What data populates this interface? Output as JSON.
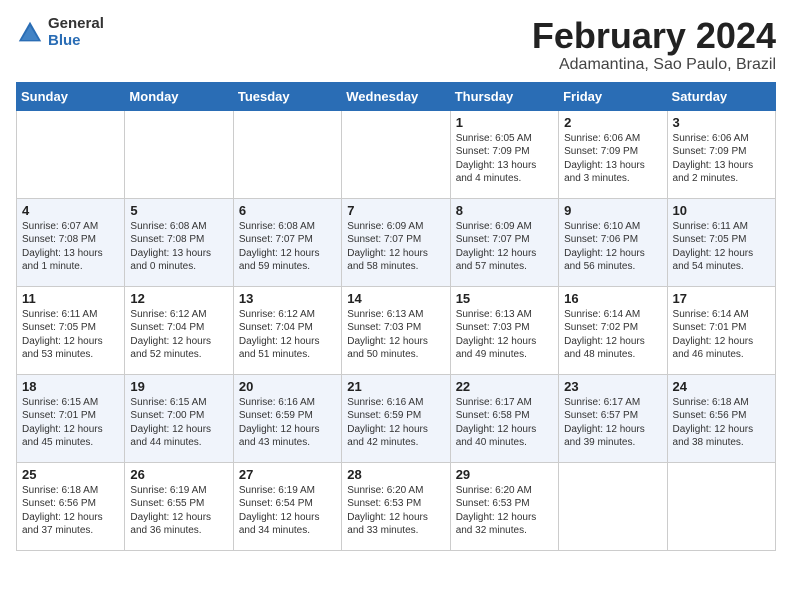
{
  "logo": {
    "general": "General",
    "blue": "Blue"
  },
  "title": {
    "month": "February 2024",
    "location": "Adamantina, Sao Paulo, Brazil"
  },
  "calendar": {
    "headers": [
      "Sunday",
      "Monday",
      "Tuesday",
      "Wednesday",
      "Thursday",
      "Friday",
      "Saturday"
    ],
    "rows": [
      [
        {
          "day": "",
          "info": ""
        },
        {
          "day": "",
          "info": ""
        },
        {
          "day": "",
          "info": ""
        },
        {
          "day": "",
          "info": ""
        },
        {
          "day": "1",
          "info": "Sunrise: 6:05 AM\nSunset: 7:09 PM\nDaylight: 13 hours\nand 4 minutes."
        },
        {
          "day": "2",
          "info": "Sunrise: 6:06 AM\nSunset: 7:09 PM\nDaylight: 13 hours\nand 3 minutes."
        },
        {
          "day": "3",
          "info": "Sunrise: 6:06 AM\nSunset: 7:09 PM\nDaylight: 13 hours\nand 2 minutes."
        }
      ],
      [
        {
          "day": "4",
          "info": "Sunrise: 6:07 AM\nSunset: 7:08 PM\nDaylight: 13 hours\nand 1 minute."
        },
        {
          "day": "5",
          "info": "Sunrise: 6:08 AM\nSunset: 7:08 PM\nDaylight: 13 hours\nand 0 minutes."
        },
        {
          "day": "6",
          "info": "Sunrise: 6:08 AM\nSunset: 7:07 PM\nDaylight: 12 hours\nand 59 minutes."
        },
        {
          "day": "7",
          "info": "Sunrise: 6:09 AM\nSunset: 7:07 PM\nDaylight: 12 hours\nand 58 minutes."
        },
        {
          "day": "8",
          "info": "Sunrise: 6:09 AM\nSunset: 7:07 PM\nDaylight: 12 hours\nand 57 minutes."
        },
        {
          "day": "9",
          "info": "Sunrise: 6:10 AM\nSunset: 7:06 PM\nDaylight: 12 hours\nand 56 minutes."
        },
        {
          "day": "10",
          "info": "Sunrise: 6:11 AM\nSunset: 7:05 PM\nDaylight: 12 hours\nand 54 minutes."
        }
      ],
      [
        {
          "day": "11",
          "info": "Sunrise: 6:11 AM\nSunset: 7:05 PM\nDaylight: 12 hours\nand 53 minutes."
        },
        {
          "day": "12",
          "info": "Sunrise: 6:12 AM\nSunset: 7:04 PM\nDaylight: 12 hours\nand 52 minutes."
        },
        {
          "day": "13",
          "info": "Sunrise: 6:12 AM\nSunset: 7:04 PM\nDaylight: 12 hours\nand 51 minutes."
        },
        {
          "day": "14",
          "info": "Sunrise: 6:13 AM\nSunset: 7:03 PM\nDaylight: 12 hours\nand 50 minutes."
        },
        {
          "day": "15",
          "info": "Sunrise: 6:13 AM\nSunset: 7:03 PM\nDaylight: 12 hours\nand 49 minutes."
        },
        {
          "day": "16",
          "info": "Sunrise: 6:14 AM\nSunset: 7:02 PM\nDaylight: 12 hours\nand 48 minutes."
        },
        {
          "day": "17",
          "info": "Sunrise: 6:14 AM\nSunset: 7:01 PM\nDaylight: 12 hours\nand 46 minutes."
        }
      ],
      [
        {
          "day": "18",
          "info": "Sunrise: 6:15 AM\nSunset: 7:01 PM\nDaylight: 12 hours\nand 45 minutes."
        },
        {
          "day": "19",
          "info": "Sunrise: 6:15 AM\nSunset: 7:00 PM\nDaylight: 12 hours\nand 44 minutes."
        },
        {
          "day": "20",
          "info": "Sunrise: 6:16 AM\nSunset: 6:59 PM\nDaylight: 12 hours\nand 43 minutes."
        },
        {
          "day": "21",
          "info": "Sunrise: 6:16 AM\nSunset: 6:59 PM\nDaylight: 12 hours\nand 42 minutes."
        },
        {
          "day": "22",
          "info": "Sunrise: 6:17 AM\nSunset: 6:58 PM\nDaylight: 12 hours\nand 40 minutes."
        },
        {
          "day": "23",
          "info": "Sunrise: 6:17 AM\nSunset: 6:57 PM\nDaylight: 12 hours\nand 39 minutes."
        },
        {
          "day": "24",
          "info": "Sunrise: 6:18 AM\nSunset: 6:56 PM\nDaylight: 12 hours\nand 38 minutes."
        }
      ],
      [
        {
          "day": "25",
          "info": "Sunrise: 6:18 AM\nSunset: 6:56 PM\nDaylight: 12 hours\nand 37 minutes."
        },
        {
          "day": "26",
          "info": "Sunrise: 6:19 AM\nSunset: 6:55 PM\nDaylight: 12 hours\nand 36 minutes."
        },
        {
          "day": "27",
          "info": "Sunrise: 6:19 AM\nSunset: 6:54 PM\nDaylight: 12 hours\nand 34 minutes."
        },
        {
          "day": "28",
          "info": "Sunrise: 6:20 AM\nSunset: 6:53 PM\nDaylight: 12 hours\nand 33 minutes."
        },
        {
          "day": "29",
          "info": "Sunrise: 6:20 AM\nSunset: 6:53 PM\nDaylight: 12 hours\nand 32 minutes."
        },
        {
          "day": "",
          "info": ""
        },
        {
          "day": "",
          "info": ""
        }
      ]
    ]
  }
}
